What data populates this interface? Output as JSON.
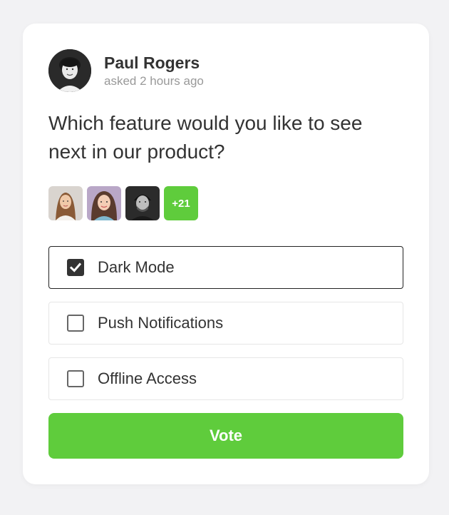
{
  "author": {
    "name": "Paul Rogers",
    "meta": "asked 2 hours ago"
  },
  "question": "Which feature would you like to see next in our product?",
  "voters": {
    "more_count": "+21"
  },
  "options": [
    {
      "label": "Dark Mode",
      "checked": true
    },
    {
      "label": "Push Notifications",
      "checked": false
    },
    {
      "label": "Offline Access",
      "checked": false
    }
  ],
  "vote_button": "Vote",
  "colors": {
    "accent": "#5fcc3c",
    "text": "#333333",
    "muted": "#999999",
    "background": "#f2f2f4"
  }
}
